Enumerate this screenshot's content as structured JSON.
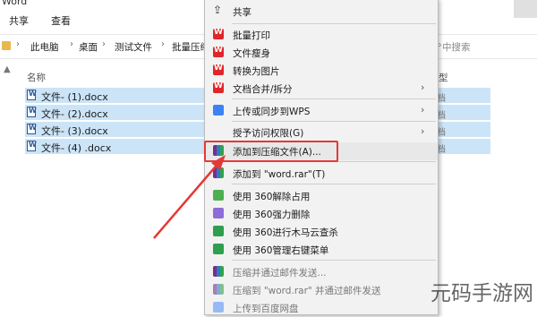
{
  "explorer": {
    "title_fragment": "Word",
    "tabs": [
      "共享",
      "查看"
    ],
    "breadcrumbs": [
      "此电脑",
      "桌面",
      "测试文件",
      "批量压缩"
    ],
    "search_placeholder": "中搜索",
    "column_name": "名称",
    "column_type_fragment": "型",
    "files": [
      {
        "name": "文件- (1).docx",
        "type": "档"
      },
      {
        "name": "文件- (2).docx",
        "type": "档"
      },
      {
        "name": "文件- (3).docx",
        "type": "档"
      },
      {
        "name": "文件- (4) .docx",
        "type": "档"
      }
    ]
  },
  "context_menu": {
    "items": [
      {
        "label": "共享",
        "icon": "share-icon"
      },
      {
        "label": "批量打印",
        "icon": "wps-icon"
      },
      {
        "label": "文件瘦身",
        "icon": "wps-icon"
      },
      {
        "label": "转换为图片",
        "icon": "wps-icon"
      },
      {
        "label": "文档合并/拆分",
        "icon": "wps-icon",
        "submenu": true
      },
      {
        "label": "上传或同步到WPS",
        "icon": "cloud-icon",
        "submenu": true
      },
      {
        "label": "授予访问权限(G)",
        "submenu": true
      },
      {
        "label": "添加到压缩文件(A)...",
        "icon": "winrar-icon",
        "highlighted": true
      },
      {
        "label": "添加到 \"word.rar\"(T)",
        "icon": "winrar-icon"
      },
      {
        "label": "使用 360解除占用",
        "icon": "360-unlock-icon"
      },
      {
        "label": "使用 360强力删除",
        "icon": "360-delete-icon"
      },
      {
        "label": "使用 360进行木马云查杀",
        "icon": "360-scan-icon"
      },
      {
        "label": "使用 360管理右键菜单",
        "icon": "360-menu-icon"
      },
      {
        "label": "压缩并通过邮件发送...",
        "icon": "winrar-icon"
      },
      {
        "label": "压缩到 \"word.rar\" 并通过邮件发送",
        "icon": "winrar-icon"
      },
      {
        "label": "上传到百度网盘",
        "icon": "baidu-icon"
      }
    ]
  },
  "watermark": "元码手游网"
}
